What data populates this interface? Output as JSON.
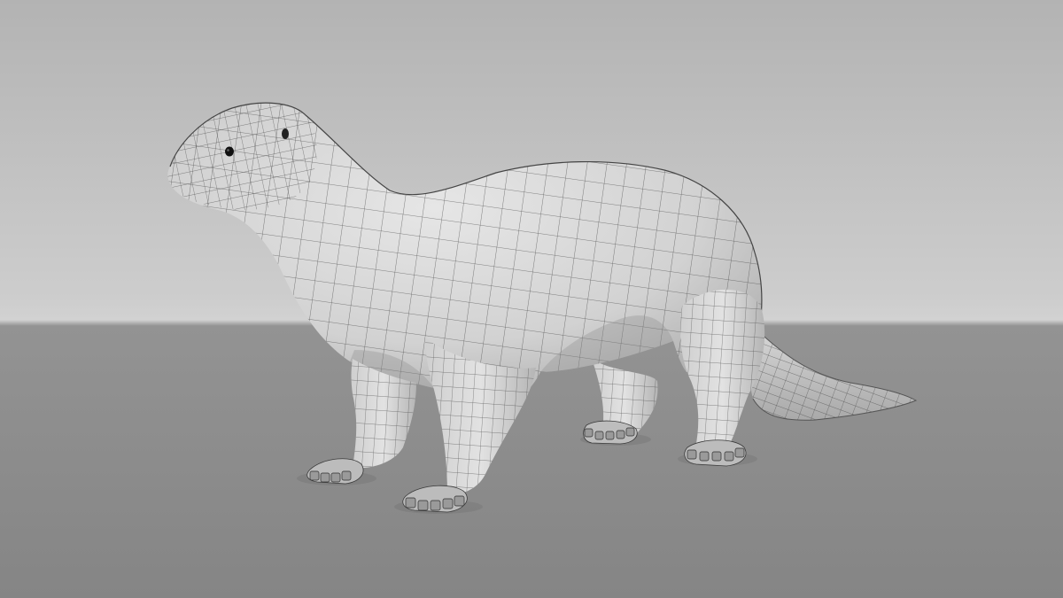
{
  "scene": {
    "subject": "otter-wireframe-mesh",
    "background_top_color": "#b7b7b7",
    "background_horizon_color": "#cfcfcf",
    "floor_color": "#8c8c8c",
    "mesh_surface_color": "#d9d9d9",
    "mesh_shadow_color": "#9a9a9a",
    "wire_color": "#3a3a3a",
    "eye_color": "#111111"
  }
}
